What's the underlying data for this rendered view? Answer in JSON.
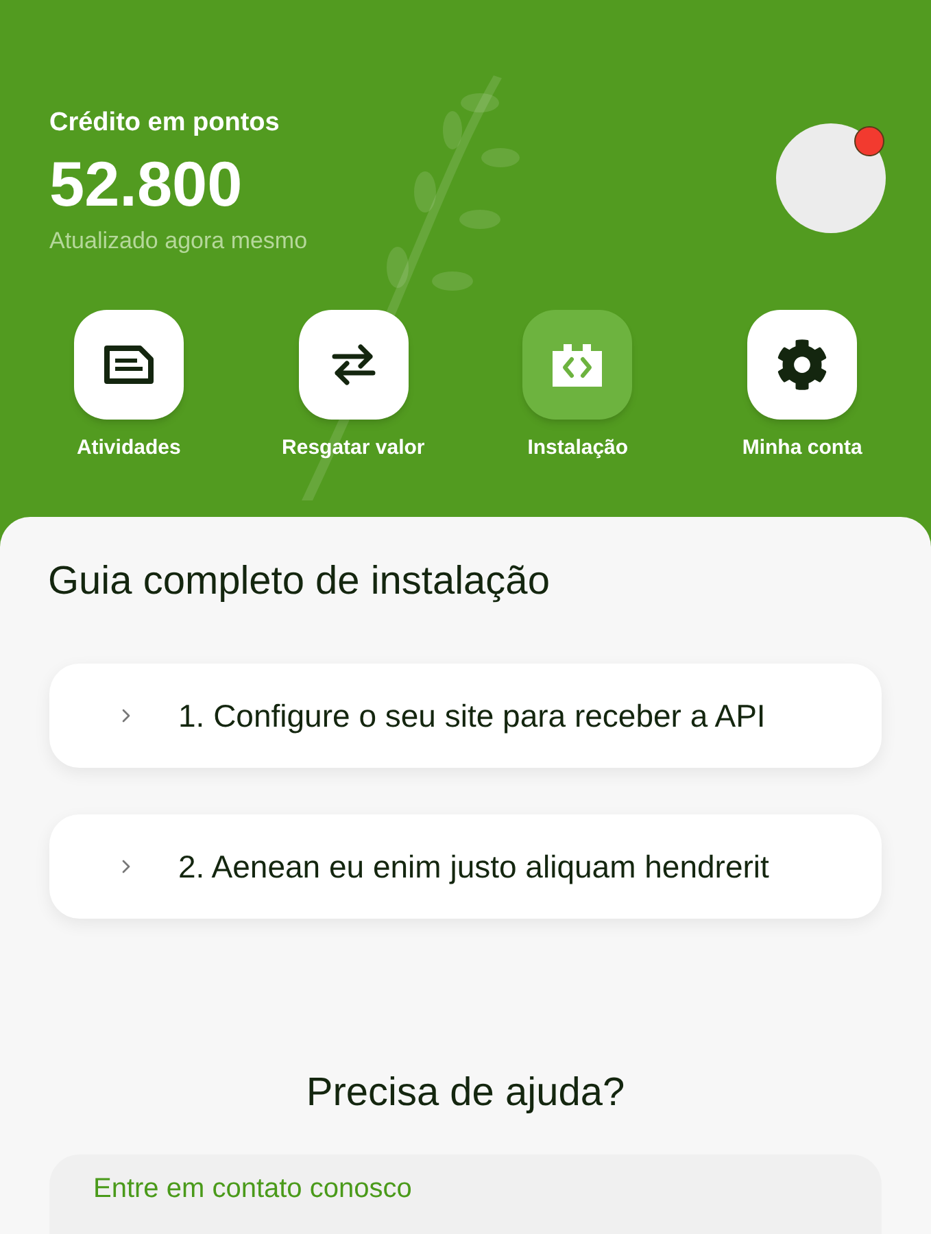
{
  "header": {
    "label": "Crédito em pontos",
    "points": "52.800",
    "updated": "Atualizado agora mesmo",
    "avatar": {
      "notification": true
    }
  },
  "nav": [
    {
      "label": "Atividades",
      "kind": "document",
      "selected": false
    },
    {
      "label": "Resgatar valor",
      "kind": "swap",
      "selected": false
    },
    {
      "label": "Instalação",
      "kind": "code",
      "selected": true
    },
    {
      "label": "Minha conta",
      "kind": "gear",
      "selected": false
    }
  ],
  "guide": {
    "title": "Guia completo de instalação",
    "items": [
      {
        "label": "1. Configure o seu site para receber a API",
        "expanded": false
      },
      {
        "label": "2. Aenean eu enim justo aliquam hendrerit",
        "expanded": false
      }
    ]
  },
  "help": {
    "title": "Precisa de ajuda?",
    "contact": "Entre em contato conosco"
  }
}
